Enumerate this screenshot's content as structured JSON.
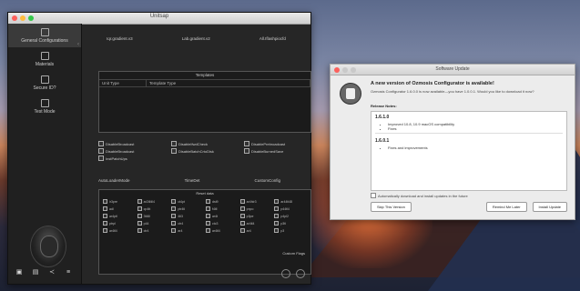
{
  "main_window": {
    "title": "Unitsap",
    "sidebar": {
      "items": [
        {
          "label": "General Configurations",
          "icon": "gear-icon",
          "active": true
        },
        {
          "label": "Materials",
          "icon": "materials-icon"
        },
        {
          "label": "Secure ID?",
          "icon": "secure-icon"
        },
        {
          "label": "Test Mode",
          "icon": "test-icon"
        }
      ]
    },
    "tabs": [
      "Iqr.gradient.v3",
      "Lab.gradient.v2",
      "All.Iflashpiocfd"
    ],
    "templates": {
      "title": "Templates",
      "columns": [
        "Unit Type",
        "Template Type"
      ]
    },
    "checkboxes": [
      [
        "DisableBroadcast",
        "DisableIfwdCheck",
        "DisablePrebroadcast"
      ],
      [
        "DisableBroadcast",
        "DisableBatchCrtoDisk",
        "DisableBurnedSave"
      ],
      [
        "InstPatchUps",
        "",
        ""
      ]
    ],
    "mid_tabs": [
      "AutoLoaderMode",
      "TimeDet",
      "CustomConfig"
    ],
    "reset_box": {
      "title": "Reset data",
      "items": [
        "ir3pre",
        "ar2l4tll4",
        "ct4pt",
        "dst9",
        "ar4hlr3",
        "ar44tl48",
        "adl",
        "cp4tt",
        "ptr4tl",
        "f4tll",
        "pnpo",
        "p44tl4",
        "ar4ptl",
        "3tl4ll",
        "4tl3",
        "ar4t",
        "p3pe",
        "p4pl2",
        "ptrpl",
        "p44",
        "ctr4",
        "ctc3",
        "ar4tl4",
        "p3tl",
        "ar4tl4",
        "ctr4",
        "ar4",
        "ar4tl4",
        "ar4",
        "p3"
      ],
      "custom_label": "Custom Flags"
    }
  },
  "update_dialog": {
    "title": "Software Update",
    "heading": "A new version of Ozmosis Configurator is available!",
    "subtext": "Ozmosis Configurator 1.6.0.0 is now available—you have 1.0.0.1. Would you like to download it now?",
    "release_notes_label": "Release Notes:",
    "notes": [
      {
        "version": "1.6.1.0",
        "items": [
          "Improved 10.8, 10.9 macOS compatibility",
          "Fixes"
        ]
      },
      {
        "version": "1.6.0.1",
        "items": [
          "Fixes and improvements"
        ]
      }
    ],
    "auto_label": "Automatically download and install updates in the future",
    "buttons": {
      "skip": "Skip This Version",
      "later": "Remind Me Later",
      "install": "Install Update"
    }
  },
  "colors": {
    "window_bg": "#262626",
    "dialog_bg": "#ececec"
  }
}
